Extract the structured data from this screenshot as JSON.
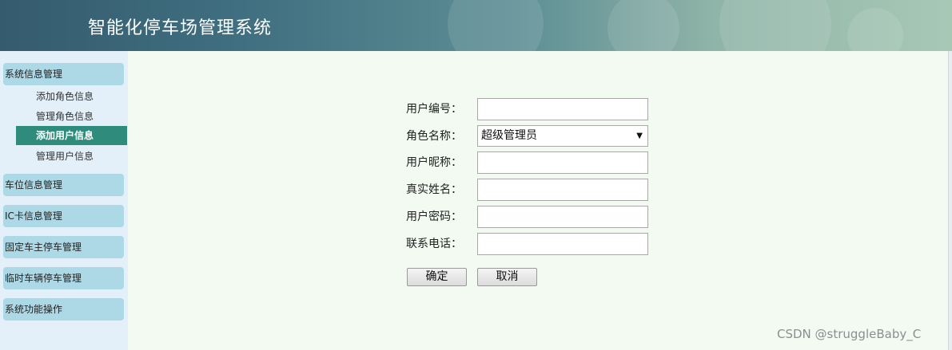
{
  "header": {
    "title": "智能化停车场管理系统"
  },
  "sidebar": {
    "groups": [
      {
        "label": "系统信息管理",
        "items": [
          {
            "label": "添加角色信息"
          },
          {
            "label": "管理角色信息"
          },
          {
            "label": "添加用户信息",
            "active": true
          },
          {
            "label": "管理用户信息"
          }
        ]
      },
      {
        "label": "车位信息管理"
      },
      {
        "label": "IC卡信息管理"
      },
      {
        "label": "固定车主停车管理"
      },
      {
        "label": "临时车辆停车管理"
      },
      {
        "label": "系统功能操作"
      }
    ]
  },
  "form": {
    "user_id_label": "用户编号：",
    "user_id_value": "",
    "role_label": "角色名称：",
    "role_selected": "超级管理员",
    "nickname_label": "用户昵称：",
    "nickname_value": "",
    "realname_label": "真实姓名：",
    "realname_value": "",
    "password_label": "用户密码：",
    "password_value": "",
    "phone_label": "联系电话：",
    "phone_value": "",
    "confirm_label": "确定",
    "cancel_label": "取消"
  },
  "watermark": "CSDN @struggleBaby_C",
  "colors": {
    "sidebar_group_bg": "#add8e6",
    "sidebar_active_bg": "#2f8c7c",
    "sidebar_bg": "#e3f0fa",
    "main_bg": "#f2faf2"
  }
}
